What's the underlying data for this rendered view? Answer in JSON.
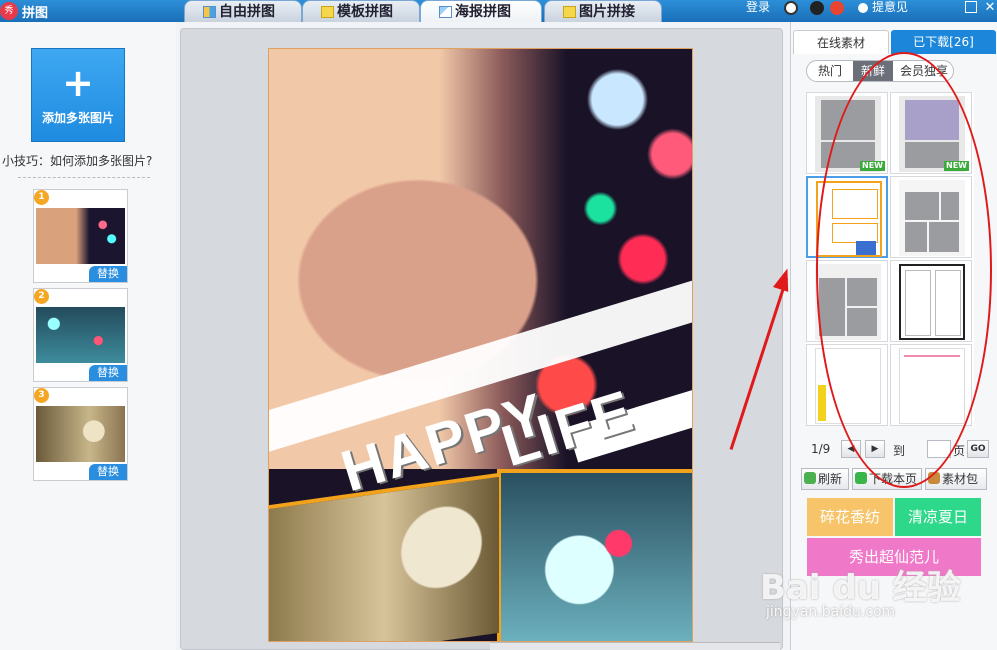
{
  "app": {
    "title": "拼图",
    "logo_text": "秀"
  },
  "tabs": [
    {
      "label": "自由拼图"
    },
    {
      "label": "模板拼图"
    },
    {
      "label": "海报拼图"
    },
    {
      "label": "图片拼接"
    }
  ],
  "header": {
    "login": "登录",
    "feedback": "提意见"
  },
  "left": {
    "add_label": "添加多张图片",
    "tip": "小技巧：如何添加多张图片?",
    "thumbs": [
      {
        "num": "1",
        "replace": "替换"
      },
      {
        "num": "2",
        "replace": "替换"
      },
      {
        "num": "3",
        "replace": "替换"
      }
    ]
  },
  "poster": {
    "text1": "HAPPY",
    "text2": "LIFE"
  },
  "right": {
    "tab_online": "在线素材",
    "tab_downloaded": "已下载[26]",
    "subtabs": [
      "热门",
      "新鲜",
      "会员独享"
    ],
    "new_badge": "NEW",
    "pager": {
      "current": "1/9",
      "to": "到",
      "page": "页",
      "go": "GO"
    },
    "actions": [
      "刷新",
      "下载本页",
      "素材包"
    ],
    "banners": [
      "碎花香纺",
      "清凉夏日",
      "秀出超仙范儿"
    ]
  },
  "watermark": {
    "main": "Bai du 经验",
    "sub": "jingyan.baidu.com"
  },
  "colors": {
    "accent": "#1c87da",
    "annotation": "#e01a1a",
    "tab_active_bg": "#ffffff"
  }
}
